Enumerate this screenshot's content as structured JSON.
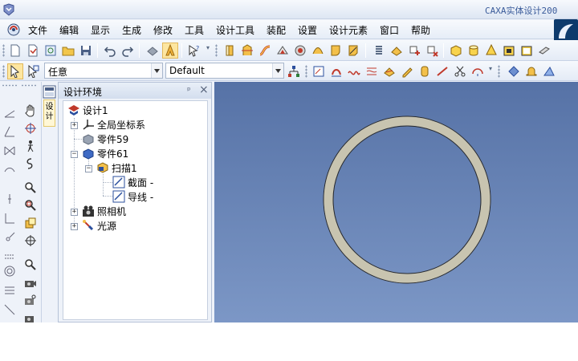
{
  "window": {
    "title": "CAXA实体设计200",
    "icon": "caxa-logo-icon"
  },
  "menu": {
    "items": [
      "文件",
      "编辑",
      "显示",
      "生成",
      "修改",
      "工具",
      "设计工具",
      "装配",
      "设置",
      "设计元素",
      "窗口",
      "帮助"
    ]
  },
  "toolbar": {
    "selection_filter": "任意",
    "style_combo": "Default"
  },
  "panel": {
    "title": "设计环境",
    "side_tab_label": "设计",
    "pin_glyph": "ᵖ",
    "close_glyph": "×"
  },
  "tree": {
    "root": "设计1",
    "global_coords": "全局坐标系",
    "part59": "零件59",
    "part61": "零件61",
    "sweep": "扫描1",
    "section": "截面 -",
    "guide": "导线 -",
    "camera": "照相机",
    "light": "光源"
  },
  "viewport": {
    "background_top": "#5672a6",
    "background_bottom": "#7c97c6",
    "ring_color": "#c8c4b0"
  }
}
